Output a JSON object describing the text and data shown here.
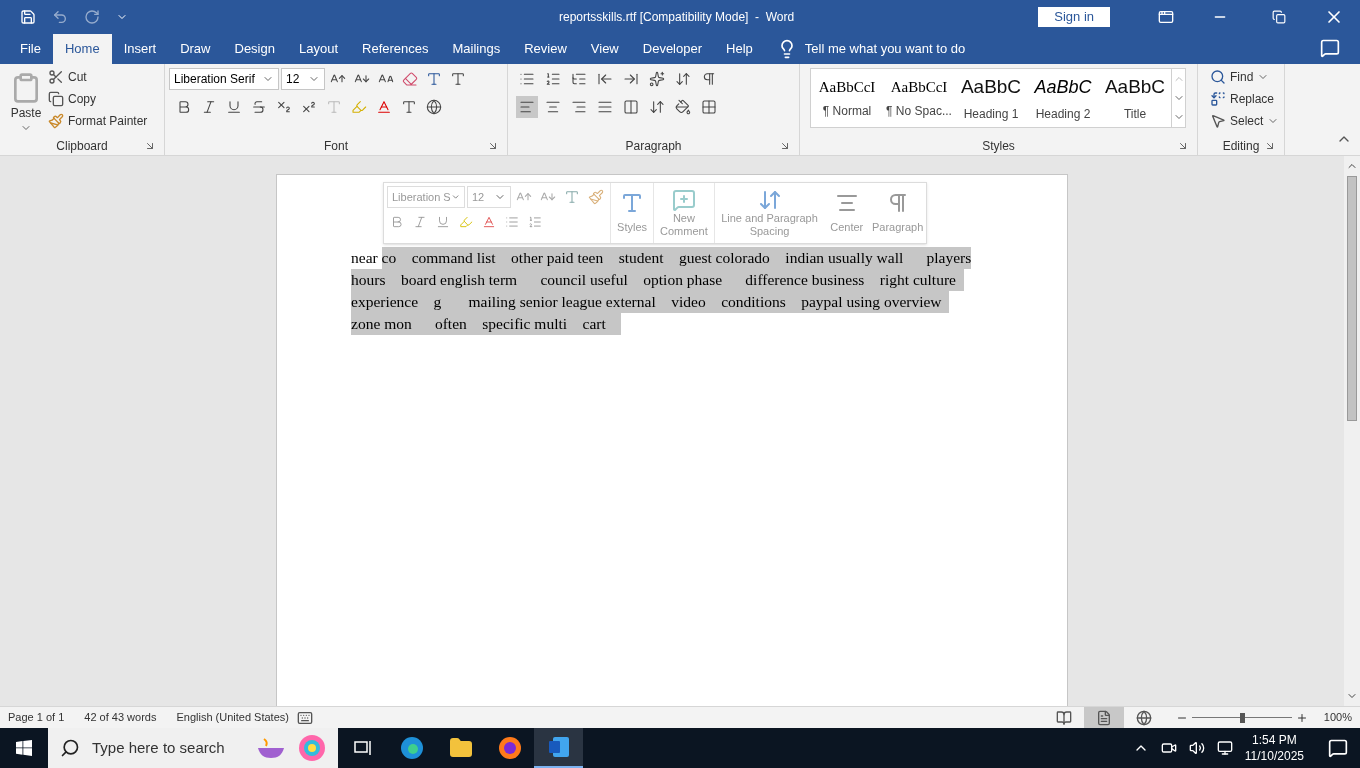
{
  "window": {
    "title": "reportsskills.rtf [Compatibility Mode]  -  Word",
    "sign_in": "Sign in"
  },
  "tabs": [
    {
      "label": "File",
      "selected": false
    },
    {
      "label": "Home",
      "selected": true
    },
    {
      "label": "Insert",
      "selected": false
    },
    {
      "label": "Draw",
      "selected": false
    },
    {
      "label": "Design",
      "selected": false
    },
    {
      "label": "Layout",
      "selected": false
    },
    {
      "label": "References",
      "selected": false
    },
    {
      "label": "Mailings",
      "selected": false
    },
    {
      "label": "Review",
      "selected": false
    },
    {
      "label": "View",
      "selected": false
    },
    {
      "label": "Developer",
      "selected": false
    },
    {
      "label": "Help",
      "selected": false
    }
  ],
  "tell_me": "Tell me what you want to do",
  "clipboard": {
    "label": "Clipboard",
    "paste": "Paste",
    "cut": "Cut",
    "copy": "Copy",
    "format_painter": "Format Painter"
  },
  "font": {
    "label": "Font",
    "name": "Liberation Serif",
    "size": "12"
  },
  "paragraph": {
    "label": "Paragraph"
  },
  "styles": {
    "label": "Styles",
    "items": [
      {
        "preview": "AaBbCcI",
        "name": "¶ Normal",
        "kind": "normal"
      },
      {
        "preview": "AaBbCcI",
        "name": "¶ No Spac...",
        "kind": "normal"
      },
      {
        "preview": "AaBbC",
        "name": "Heading 1",
        "kind": "heading"
      },
      {
        "preview": "AaBbC",
        "name": "Heading 2",
        "kind": "italic"
      },
      {
        "preview": "AaBbC",
        "name": "Title",
        "kind": "heading"
      }
    ]
  },
  "editing": {
    "label": "Editing",
    "find": "Find",
    "replace": "Replace",
    "select": "Select"
  },
  "mini_toolbar": {
    "font": "Liberation S",
    "size": "12",
    "styles": "Styles",
    "new_comment": "New Comment",
    "spacing": "Line and Paragraph Spacing",
    "center": "Center",
    "paragraph": "Paragraph"
  },
  "document": {
    "lines": [
      [
        {
          "text": "near ",
          "selected": false
        },
        {
          "text": "co    command list    other paid teen    student    guest colorado    indian usually wall      players",
          "selected": true
        }
      ],
      [
        {
          "text": "hours    board english term      council useful    option phase      difference business    right culture  ",
          "selected": true
        }
      ],
      [
        {
          "text": "experience    g       mailing senior league external    video    conditions    paypal using overview  ",
          "selected": true
        }
      ],
      [
        {
          "text": "zone mon      often    specific multi    cart    ",
          "selected": true
        }
      ]
    ]
  },
  "status_bar": {
    "page": "Page 1 of 1",
    "words": "42 of 43 words",
    "language": "English (United States)",
    "views": [
      {
        "kind": "read",
        "selected": false
      },
      {
        "kind": "print",
        "selected": true
      },
      {
        "kind": "web",
        "selected": false
      }
    ],
    "zoom": {
      "level": 0.5,
      "reading": "100%"
    }
  },
  "taskbar": {
    "search": {
      "placeholder": "Type here to search"
    },
    "apps": [
      {
        "kind": "taskview",
        "selected": false
      },
      {
        "kind": "edge",
        "selected": false
      },
      {
        "kind": "explorer",
        "selected": false
      },
      {
        "kind": "firefox",
        "selected": false
      },
      {
        "kind": "word",
        "selected": true
      }
    ],
    "time": "1:54 PM",
    "date": "11/10/2025"
  }
}
